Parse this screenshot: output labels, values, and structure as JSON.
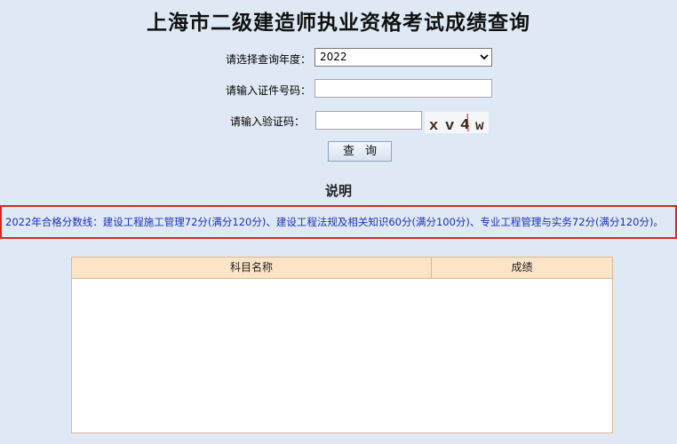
{
  "page": {
    "title": "上海市二级建造师执业资格考试成绩查询"
  },
  "form": {
    "year_label": "请选择查询年度：",
    "year_value": "2022",
    "id_label": "请输入证件号码：",
    "id_value": "",
    "captcha_label": "请输入验证码：",
    "captcha_value": "",
    "captcha_text": "xv4w",
    "query_button": "查询"
  },
  "explanation": {
    "title": "说明",
    "notice": "2022年合格分数线：建设工程施工管理72分(满分120分)、建设工程法规及相关知识60分(满分100分)、专业工程管理与实务72分(满分120分)。"
  },
  "results": {
    "columns": [
      "科目名称",
      "成绩"
    ],
    "rows": []
  },
  "colors": {
    "background": "#dfe9f5",
    "notice_text": "#1d2fb8",
    "notice_border": "#e02424",
    "table_header_bg": "#fde4c6"
  }
}
